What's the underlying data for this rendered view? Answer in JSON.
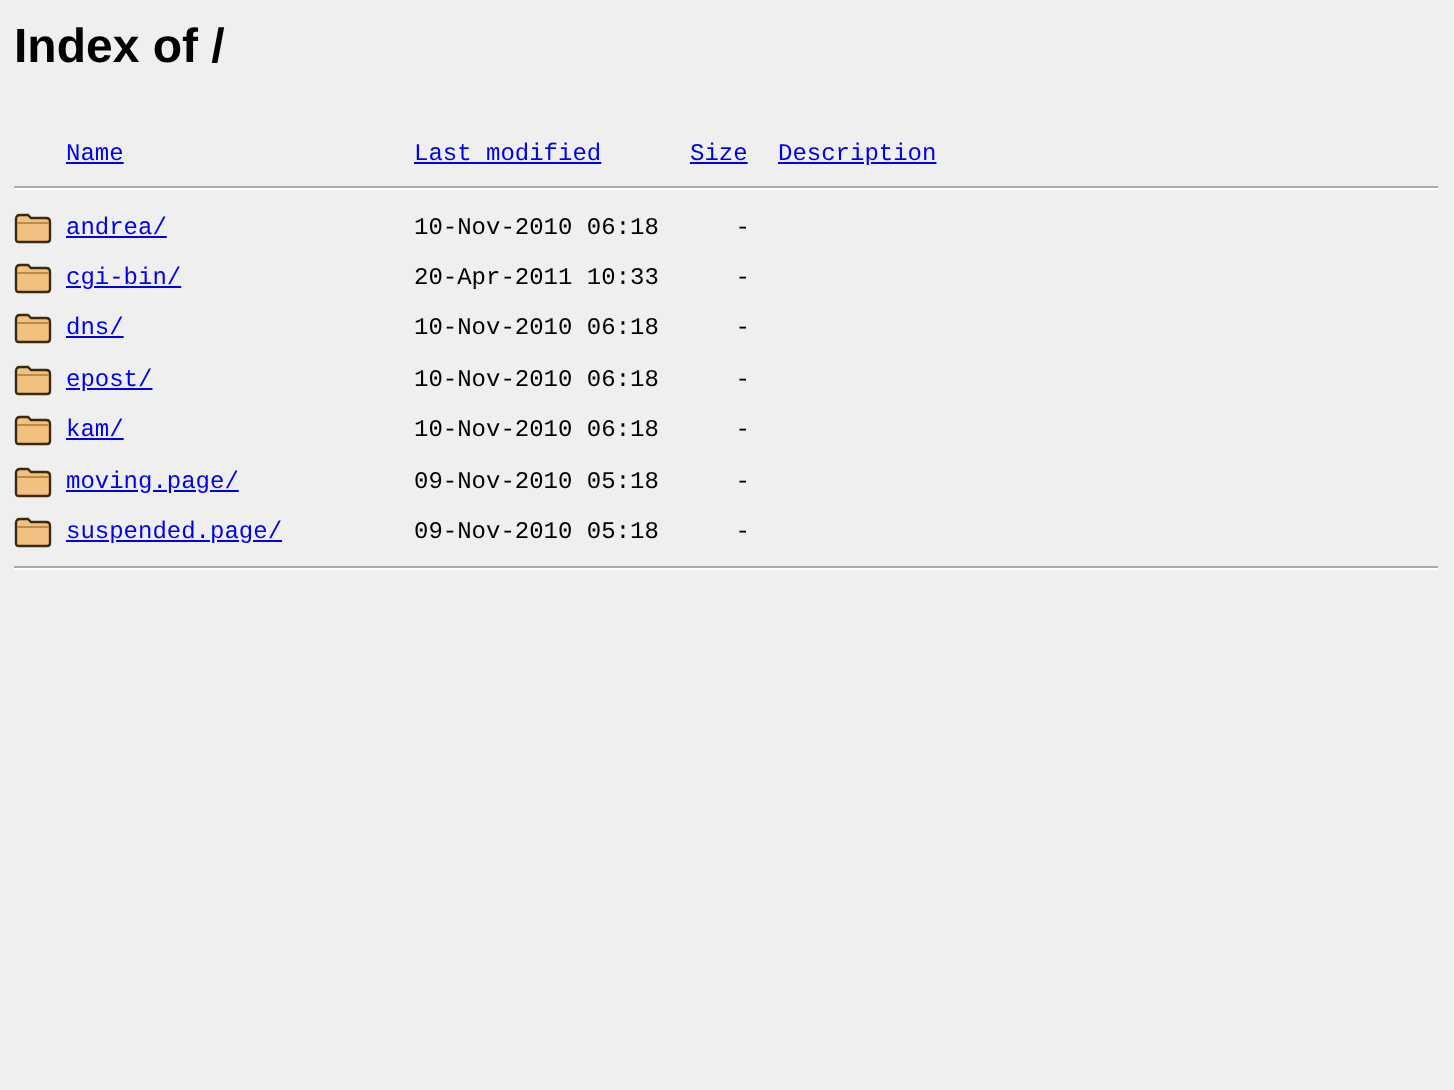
{
  "title": "Index of /",
  "columns": [
    "Name",
    "Last modified",
    "Size",
    "Description"
  ],
  "entries": [
    {
      "name": "andrea/",
      "modified": "10-Nov-2010 06:18",
      "size": "-"
    },
    {
      "name": "cgi-bin/",
      "modified": "20-Apr-2011 10:33",
      "size": "-"
    },
    {
      "name": "dns/",
      "modified": "10-Nov-2010 06:18",
      "size": "-"
    },
    {
      "name": "epost/",
      "modified": "10-Nov-2010 06:18",
      "size": "-"
    },
    {
      "name": "kam/",
      "modified": "10-Nov-2010 06:18",
      "size": "-"
    },
    {
      "name": "moving.page/",
      "modified": "09-Nov-2010 05:18",
      "size": "-"
    },
    {
      "name": "suspended.page/",
      "modified": "09-Nov-2010 05:18",
      "size": "-"
    }
  ]
}
